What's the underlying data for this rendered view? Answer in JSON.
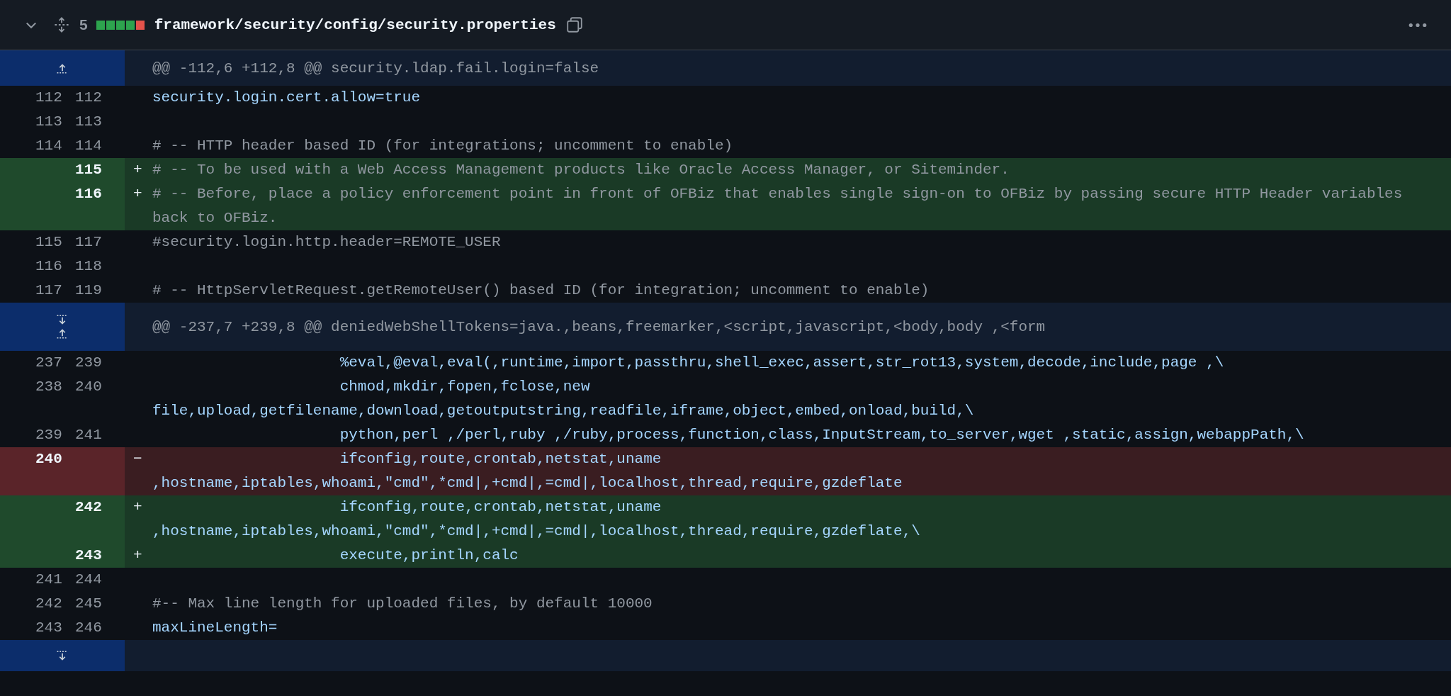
{
  "file_header": {
    "expanded": true,
    "changes": "5",
    "diffstat": [
      {
        "kind": "added"
      },
      {
        "kind": "added"
      },
      {
        "kind": "added"
      },
      {
        "kind": "added"
      },
      {
        "kind": "deleted"
      }
    ],
    "path": "framework/security/config/security.properties"
  },
  "rows": [
    {
      "kind": "hunk",
      "expand_up": true,
      "text": "@@ -112,6 +112,8 @@ security.ldap.fail.login=false"
    },
    {
      "kind": "context",
      "comment": false,
      "old": "112",
      "new": "112",
      "text": "security.login.cert.allow=true"
    },
    {
      "kind": "context",
      "old": "113",
      "new": "113"
    },
    {
      "kind": "context",
      "comment": true,
      "old": "114",
      "new": "114",
      "text": "# -- HTTP header based ID (for integrations; uncomment to enable)"
    },
    {
      "kind": "add",
      "comment": true,
      "new": "115",
      "marker": "+",
      "text": "# -- To be used with a Web Access Management products like Oracle Access Manager, or Siteminder."
    },
    {
      "kind": "add",
      "comment": true,
      "new": "116",
      "marker": "+",
      "text": "# -- Before, place a policy enforcement point in front of OFBiz that enables single sign-on to OFBiz by passing secure HTTP Header variables back to OFBiz."
    },
    {
      "kind": "context",
      "comment": true,
      "old": "115",
      "new": "117",
      "text": "#security.login.http.header=REMOTE_USER"
    },
    {
      "kind": "context",
      "old": "116",
      "new": "118"
    },
    {
      "kind": "context",
      "comment": true,
      "old": "117",
      "new": "119",
      "text": "# -- HttpServletRequest.getRemoteUser() based ID (for integration; uncomment to enable)"
    },
    {
      "kind": "hunk",
      "expand_up": true,
      "expand_down": true,
      "text": "@@ -237,7 +239,8 @@ deniedWebShellTokens=java.,beans,freemarker,<script,javascript,<body,body ,<form"
    },
    {
      "kind": "context",
      "comment": false,
      "old": "237",
      "new": "239",
      "text": "                     %eval,@eval,eval(,runtime,import,passthru,shell_exec,assert,str_rot13,system,decode,include,page ,\\"
    },
    {
      "kind": "context",
      "comment": false,
      "old": "238",
      "new": "240",
      "text": "                     chmod,mkdir,fopen,fclose,new file,upload,getfilename,download,getoutputstring,readfile,iframe,object,embed,onload,build,\\"
    },
    {
      "kind": "context",
      "comment": false,
      "old": "239",
      "new": "241",
      "text": "                     python,perl ,/perl,ruby ,/ruby,process,function,class,InputStream,to_server,wget ,static,assign,webappPath,\\"
    },
    {
      "kind": "del",
      "comment": false,
      "old": "240",
      "marker": "−",
      "text": "                     ifconfig,route,crontab,netstat,uname ,hostname,iptables,whoami,\"cmd\",*cmd|,+cmd|,=cmd|,localhost,thread,require,gzdeflate"
    },
    {
      "kind": "add",
      "comment": false,
      "new": "242",
      "marker": "+",
      "text": "                     ifconfig,route,crontab,netstat,uname ,hostname,iptables,whoami,\"cmd\",*cmd|,+cmd|,=cmd|,localhost,thread,require,gzdeflate,\\"
    },
    {
      "kind": "add",
      "comment": false,
      "new": "243",
      "marker": "+",
      "text": "                     execute,println,calc"
    },
    {
      "kind": "context",
      "old": "241",
      "new": "244"
    },
    {
      "kind": "context",
      "comment": true,
      "old": "242",
      "new": "245",
      "text": "#-- Max line length for uploaded files, by default 10000"
    },
    {
      "kind": "context",
      "comment": false,
      "old": "243",
      "new": "246",
      "text": "maxLineLength="
    },
    {
      "kind": "hunk",
      "expand_down": true
    }
  ]
}
